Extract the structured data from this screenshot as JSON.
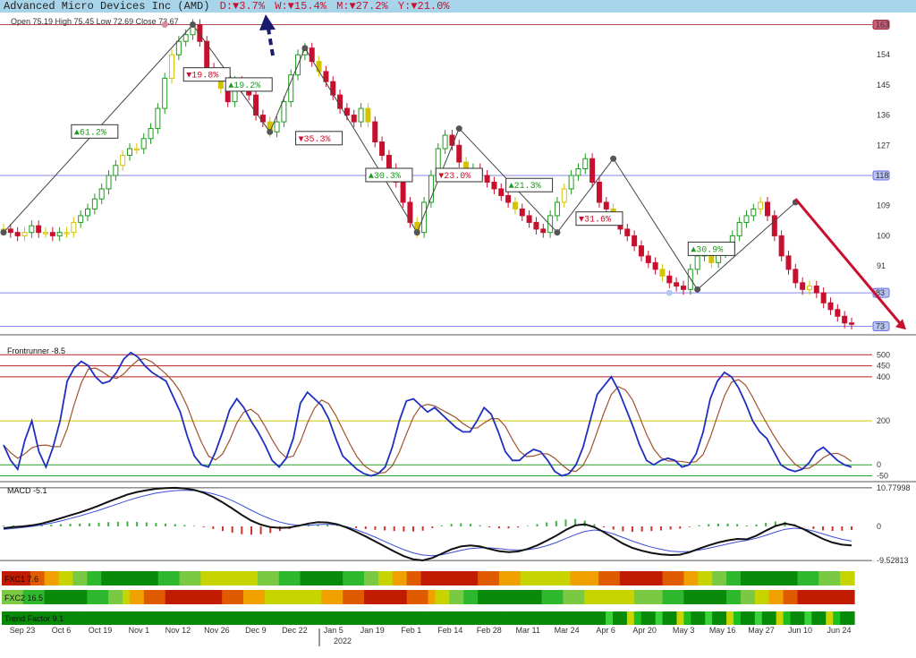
{
  "header": {
    "title": "Advanced Micro Devices Inc (AMD)",
    "day": "D:▼3.7%",
    "week": "W:▼15.4%",
    "month": "M:▼27.2%",
    "year": "Y:▼21.0%"
  },
  "colors": {
    "header_bg": "#a8d4ea",
    "up": "#1e9a1e",
    "down": "#c8102e",
    "neutral": "#d4c400",
    "swing_line": "#444444",
    "trend_arrow": "#c8102e",
    "pointer_arrow": "#1a1a6e",
    "hline_red": "#9b2335",
    "hline_blue": "#6b6bdf",
    "frontrunner": "#1f2fbf",
    "frontrunner_signal": "#a0522d",
    "macd_line": "#111111",
    "macd_signal": "#3a4bd6"
  },
  "chart_data": {
    "type": "candlestick",
    "ohlc_label": "Open 75.19  High 75.45  Low 72.69  Close 73.67",
    "x_ticks": [
      "Sep 23",
      "Oct 6",
      "Oct 19",
      "Nov 1",
      "Nov 12",
      "Nov 26",
      "Dec 9",
      "Dec 22",
      "Jan 5",
      "Jan 19",
      "Feb 1",
      "Feb 14",
      "Feb 28",
      "Mar 11",
      "Mar 24",
      "Apr 6",
      "Apr 20",
      "May 3",
      "May 16",
      "May 27",
      "Jun 10",
      "Jun 24"
    ],
    "year_label": "2022",
    "y_ticks": [
      91,
      100,
      109,
      118,
      127,
      136,
      145,
      154
    ],
    "ylim": [
      71,
      165
    ],
    "price_markers": [
      {
        "value": 163,
        "label": "163",
        "kind": "red"
      },
      {
        "value": 118,
        "label": "118",
        "kind": "blue"
      },
      {
        "value": 83,
        "label": "83",
        "kind": "blue"
      },
      {
        "value": 73,
        "label": "73",
        "kind": "blue"
      }
    ],
    "swing_points": [
      {
        "bar": 0,
        "price": 101.0
      },
      {
        "bar": 27,
        "price": 163.0
      },
      {
        "bar": 38,
        "price": 131.0
      },
      {
        "bar": 43,
        "price": 156.0
      },
      {
        "bar": 59,
        "price": 101.0
      },
      {
        "bar": 65,
        "price": 132.0
      },
      {
        "bar": 79,
        "price": 101.0
      },
      {
        "bar": 87,
        "price": 123.0
      },
      {
        "bar": 99,
        "price": 84.0
      },
      {
        "bar": 113,
        "price": 110.0
      }
    ],
    "swing_labels": [
      {
        "text": "▲61.2%",
        "dir": "up",
        "bar": 13,
        "price": 131
      },
      {
        "text": "▼19.8%",
        "dir": "down",
        "bar": 29,
        "price": 148
      },
      {
        "text": "▲19.2%",
        "dir": "up",
        "bar": 35,
        "price": 145
      },
      {
        "text": "▼35.3%",
        "dir": "down",
        "bar": 45,
        "price": 129
      },
      {
        "text": "▲30.3%",
        "dir": "up",
        "bar": 55,
        "price": 118
      },
      {
        "text": "▼23.0%",
        "dir": "down",
        "bar": 65,
        "price": 118
      },
      {
        "text": "▲21.3%",
        "dir": "up",
        "bar": 75,
        "price": 115
      },
      {
        "text": "▼31.6%",
        "dir": "down",
        "bar": 85,
        "price": 105
      },
      {
        "text": "▲30.9%",
        "dir": "up",
        "bar": 101,
        "price": 96
      }
    ],
    "trend_arrow": {
      "from_bar": 113,
      "from_price": 111,
      "to_bar": 127,
      "to_price": 72
    },
    "closes": [
      102,
      101,
      100,
      101,
      103,
      101,
      101,
      100,
      101,
      101,
      104,
      106,
      108,
      111,
      114,
      118,
      121,
      124,
      126,
      126,
      129,
      132,
      138,
      147,
      154,
      158,
      160,
      163,
      158,
      150,
      148,
      144,
      140,
      146,
      144,
      142,
      136,
      134,
      131,
      134,
      140,
      148,
      154,
      156,
      152,
      149,
      146,
      142,
      138,
      136,
      134,
      138,
      134,
      128,
      124,
      120,
      116,
      110,
      104,
      101,
      110,
      118,
      126,
      130,
      127,
      122,
      118,
      120,
      118,
      116,
      114,
      112,
      110,
      108,
      106,
      104,
      102,
      101,
      106,
      110,
      114,
      118,
      120,
      123,
      116,
      110,
      108,
      105,
      102,
      100,
      97,
      94,
      92,
      90,
      88,
      86,
      85,
      84,
      90,
      94,
      96,
      92,
      95,
      96,
      100,
      104,
      106,
      108,
      110,
      106,
      100,
      94,
      90,
      86,
      84,
      85,
      83,
      80,
      78,
      76,
      74,
      73.67
    ],
    "frontrunner": {
      "label": "Frontrunner -8.5",
      "y_ticks": [
        -50,
        0,
        200,
        400,
        450,
        500
      ],
      "ylim": [
        -60,
        550
      ],
      "values": [
        90,
        20,
        -20,
        110,
        200,
        60,
        -10,
        80,
        200,
        380,
        440,
        470,
        450,
        400,
        370,
        380,
        420,
        480,
        510,
        490,
        450,
        420,
        400,
        380,
        310,
        240,
        130,
        40,
        0,
        -10,
        60,
        150,
        250,
        300,
        260,
        200,
        150,
        90,
        20,
        -10,
        30,
        120,
        280,
        330,
        300,
        270,
        210,
        120,
        40,
        10,
        -20,
        -40,
        -50,
        -40,
        -10,
        80,
        200,
        290,
        300,
        270,
        240,
        260,
        230,
        200,
        170,
        150,
        150,
        200,
        260,
        230,
        150,
        60,
        20,
        20,
        50,
        70,
        60,
        20,
        -30,
        -50,
        -40,
        0,
        80,
        200,
        320,
        360,
        400,
        340,
        260,
        180,
        90,
        20,
        0,
        20,
        30,
        20,
        -10,
        0,
        50,
        150,
        300,
        380,
        420,
        400,
        350,
        280,
        200,
        150,
        120,
        60,
        0,
        -20,
        -30,
        -20,
        10,
        60,
        80,
        50,
        20,
        0,
        -10
      ]
    },
    "macd": {
      "label": "MACD -5.1",
      "y_ticks_text": [
        "10.77998",
        "0",
        "-9.52813"
      ],
      "ylim": [
        -10.5,
        11.5
      ],
      "line": [
        -0.5,
        -0.2,
        0.0,
        0.3,
        0.8,
        1.5,
        2.3,
        3.1,
        3.9,
        4.8,
        5.8,
        6.9,
        7.9,
        8.9,
        9.6,
        10.1,
        10.5,
        10.7,
        10.78,
        10.6,
        10.2,
        9.4,
        8.2,
        6.7,
        5.0,
        3.2,
        1.6,
        0.5,
        -0.2,
        -0.4,
        -0.3,
        0.2,
        0.8,
        1.2,
        1.1,
        0.6,
        -0.3,
        -1.5,
        -2.8,
        -4.2,
        -5.6,
        -7.0,
        -8.3,
        -9.2,
        -9.5,
        -8.8,
        -7.6,
        -6.4,
        -5.6,
        -5.3,
        -5.6,
        -6.3,
        -6.9,
        -7.2,
        -7.0,
        -6.3,
        -5.3,
        -4.0,
        -2.6,
        -1.0,
        0.3,
        0.6,
        -0.2,
        -1.6,
        -3.2,
        -4.8,
        -6.0,
        -6.8,
        -7.4,
        -7.8,
        -8.0,
        -7.9,
        -7.2,
        -6.2,
        -5.3,
        -4.5,
        -3.9,
        -3.5,
        -3.6,
        -2.6,
        -1.2,
        0.1,
        0.8,
        0.3,
        -0.8,
        -2.2,
        -3.5,
        -4.5,
        -5.1,
        -5.3
      ],
      "signal": [
        -0.8,
        -0.6,
        -0.3,
        0.0,
        0.4,
        0.9,
        1.5,
        2.2,
        2.9,
        3.7,
        4.5,
        5.4,
        6.3,
        7.2,
        8.0,
        8.7,
        9.3,
        9.7,
        10.0,
        10.1,
        10.0,
        9.7,
        9.1,
        8.3,
        7.2,
        5.9,
        4.5,
        3.2,
        2.1,
        1.2,
        0.6,
        0.3,
        0.3,
        0.5,
        0.6,
        0.4,
        -0.1,
        -0.9,
        -1.9,
        -3.0,
        -4.2,
        -5.4,
        -6.5,
        -7.4,
        -8.0,
        -8.2,
        -7.9,
        -7.3,
        -6.7,
        -6.2,
        -6.0,
        -6.0,
        -6.2,
        -6.5,
        -6.6,
        -6.5,
        -6.1,
        -5.4,
        -4.5,
        -3.4,
        -2.3,
        -1.4,
        -1.0,
        -1.3,
        -2.1,
        -3.1,
        -4.1,
        -5.0,
        -5.8,
        -6.4,
        -6.9,
        -7.1,
        -7.0,
        -6.6,
        -6.1,
        -5.5,
        -4.9,
        -4.3,
        -3.9,
        -3.3,
        -2.5,
        -1.6,
        -0.8,
        -0.5,
        -0.7,
        -1.3,
        -2.1,
        -2.9,
        -3.6,
        -4.1
      ]
    },
    "fxc1": {
      "label": "FXC1 7.6"
    },
    "fxc2": {
      "label": "FXC2 16.5"
    },
    "trend_factor": {
      "label": "Trend Factor 9.1"
    }
  }
}
